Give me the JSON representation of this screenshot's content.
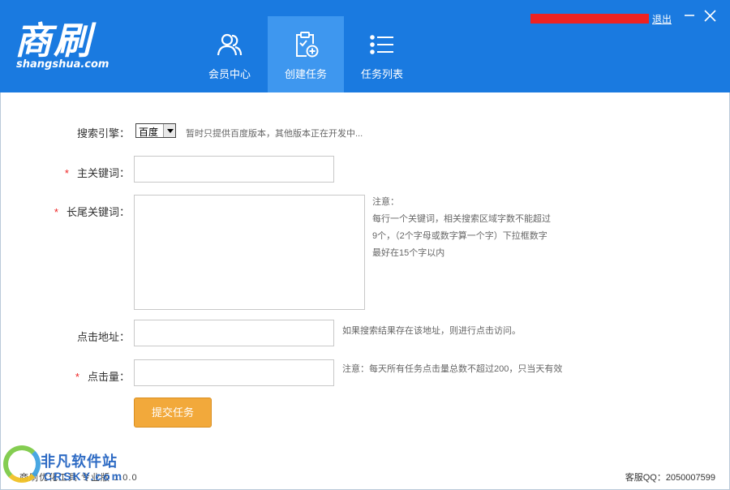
{
  "header": {
    "logo_text": "商刷",
    "logo_subtext": "shangshua.com",
    "logout_label": "退出",
    "bg_color": "#1a7ae0",
    "nav": [
      {
        "label": "会员中心",
        "icon": "members-icon",
        "active": false
      },
      {
        "label": "创建任务",
        "icon": "clipboard-add-icon",
        "active": true
      },
      {
        "label": "任务列表",
        "icon": "list-icon",
        "active": false
      }
    ]
  },
  "form": {
    "search_engine": {
      "label": "搜索引擎：",
      "selected": "百度",
      "hint": "暂时只提供百度版本，其他版本正在开发中..."
    },
    "main_keyword": {
      "required_mark": "*",
      "label": "主关键词：",
      "value": ""
    },
    "long_tail_keyword": {
      "required_mark": "*",
      "label": "长尾关键词：",
      "value": "",
      "note_lines": [
        "注意：",
        "每行一个关键词，相关搜索区域字数不能超过",
        "9个，（2个字母或数字算一个字）下拉框数字",
        "最好在15个字以内"
      ]
    },
    "click_url": {
      "label": "点击地址：",
      "value": "",
      "hint": "如果搜索结果存在该地址，则进行点击访问。"
    },
    "click_count": {
      "required_mark": "*",
      "label": "点击量：",
      "value": "",
      "hint": "注意：每天所有任务点击量总数不超过200，只当天有效"
    },
    "submit_label": "提交任务"
  },
  "footer": {
    "version": "商刷优化工具 专业版 1.0.0",
    "service": "客服QQ：2050007599"
  },
  "watermark": {
    "title": "非凡软件站",
    "subtitle": "CRSKY.com"
  },
  "colors": {
    "accent": "#1a7ae0",
    "nav_active": "#3e97ef",
    "button": "#f2a93b",
    "required": "#ee2222"
  }
}
